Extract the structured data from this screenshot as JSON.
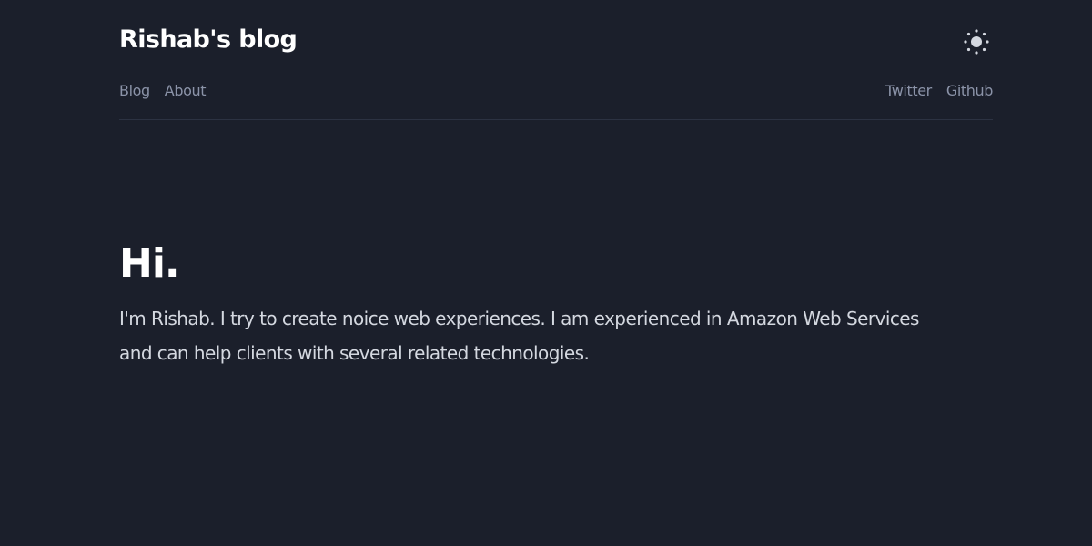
{
  "header": {
    "title": "Rishab's blog",
    "theme_toggle_icon": "sun-icon"
  },
  "nav": {
    "left": [
      {
        "label": "Blog"
      },
      {
        "label": "About"
      }
    ],
    "right": [
      {
        "label": "Twitter"
      },
      {
        "label": "Github"
      }
    ]
  },
  "hero": {
    "heading": "Hi.",
    "text": "I'm Rishab. I try to create noice web experiences. I am experienced in Amazon Web Services and can help clients with several related technologies."
  },
  "colors": {
    "background": "#1b1f2b",
    "title": "#ffffff",
    "nav_link": "#8b93a8",
    "body_text": "#d4d8e0",
    "divider": "#2c3242"
  }
}
